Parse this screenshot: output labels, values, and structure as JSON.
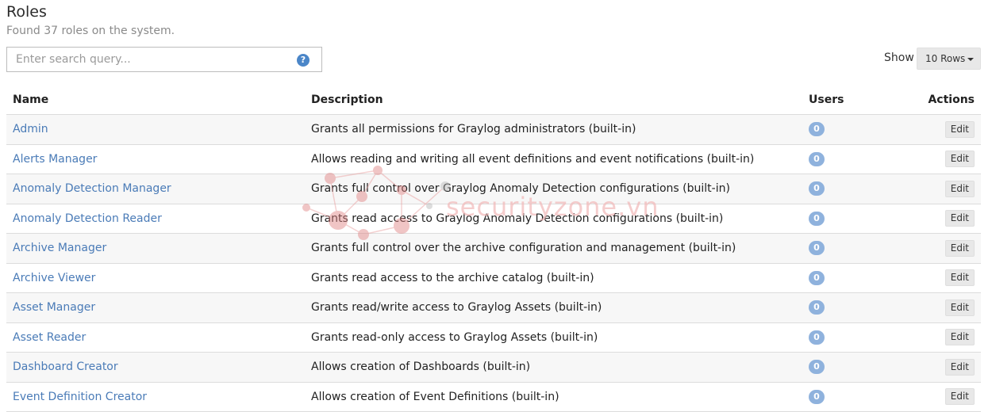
{
  "header": {
    "title": "Roles",
    "subtitle": "Found 37 roles on the system."
  },
  "search": {
    "placeholder": "Enter search query...",
    "value": "",
    "help_icon": "question-circle-icon",
    "help_glyph": "?"
  },
  "pagination": {
    "show_label": "Show",
    "rows_selected": "10 Rows"
  },
  "table": {
    "columns": [
      "Name",
      "Description",
      "Users",
      "Actions"
    ],
    "edit_label": "Edit",
    "rows": [
      {
        "name": "Admin",
        "description": "Grants all permissions for Graylog administrators (built-in)",
        "users": "0"
      },
      {
        "name": "Alerts Manager",
        "description": "Allows reading and writing all event definitions and event notifications (built-in)",
        "users": "0"
      },
      {
        "name": "Anomaly Detection Manager",
        "description": "Grants full control over Graylog Anomaly Detection configurations (built-in)",
        "users": "0"
      },
      {
        "name": "Anomaly Detection Reader",
        "description": "Grants read access to Graylog Anomaly Detection configurations (built-in)",
        "users": "0"
      },
      {
        "name": "Archive Manager",
        "description": "Grants full control over the archive configuration and management (built-in)",
        "users": "0"
      },
      {
        "name": "Archive Viewer",
        "description": "Grants read access to the archive catalog (built-in)",
        "users": "0"
      },
      {
        "name": "Asset Manager",
        "description": "Grants read/write access to Graylog Assets (built-in)",
        "users": "0"
      },
      {
        "name": "Asset Reader",
        "description": "Grants read-only access to Graylog Assets (built-in)",
        "users": "0"
      },
      {
        "name": "Dashboard Creator",
        "description": "Allows creation of Dashboards (built-in)",
        "users": "0"
      },
      {
        "name": "Event Definition Creator",
        "description": "Allows creation of Event Definitions (built-in)",
        "users": "0"
      }
    ]
  },
  "watermark": {
    "text": "securityzone.vn"
  }
}
